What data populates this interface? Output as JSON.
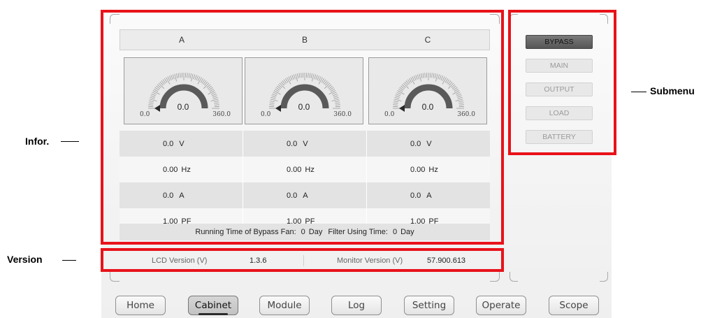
{
  "annotations": {
    "infor": "Infor.",
    "version": "Version",
    "submenu": "Submenu"
  },
  "phases": [
    "A",
    "B",
    "C"
  ],
  "gauges": [
    {
      "value": "0.0",
      "min": "0.0",
      "max": "360.0"
    },
    {
      "value": "0.0",
      "min": "0.0",
      "max": "360.0"
    },
    {
      "value": "0.0",
      "min": "0.0",
      "max": "360.0"
    }
  ],
  "measurements": [
    {
      "values": [
        "0.0",
        "0.0",
        "0.0"
      ],
      "unit": "V"
    },
    {
      "values": [
        "0.00",
        "0.00",
        "0.00"
      ],
      "unit": "Hz"
    },
    {
      "values": [
        "0.0",
        "0.0",
        "0.0"
      ],
      "unit": "A"
    },
    {
      "values": [
        "1.00",
        "1.00",
        "1.00"
      ],
      "unit": "PF"
    }
  ],
  "fan": {
    "running_label": "Running Time of Bypass Fan:",
    "running_value": "0",
    "running_unit": "Day",
    "filter_label": "Filter Using Time:",
    "filter_value": "0",
    "filter_unit": "Day"
  },
  "version": {
    "lcd_label": "LCD Version (V)",
    "lcd_value": "1.3.6",
    "monitor_label": "Monitor Version (V)",
    "monitor_value": "57.900.613"
  },
  "submenu": {
    "items": [
      "BYPASS",
      "MAIN",
      "OUTPUT",
      "LOAD",
      "BATTERY"
    ],
    "active": "BYPASS"
  },
  "nav": {
    "items": [
      "Home",
      "Cabinet",
      "Module",
      "Log",
      "Setting",
      "Operate",
      "Scope"
    ],
    "active": "Cabinet"
  },
  "colors": {
    "annotation_red": "#e8121a",
    "gauge_arc": "#5a5a5a",
    "active_submenu": "#5f5f5f"
  }
}
